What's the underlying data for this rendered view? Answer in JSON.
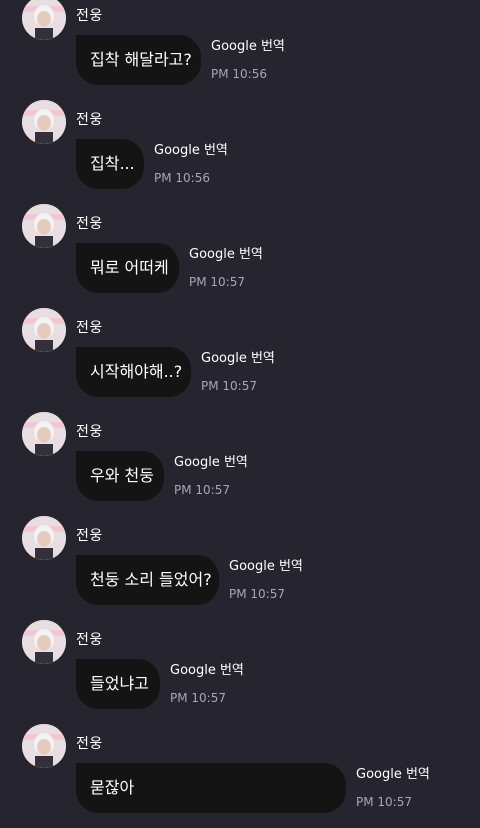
{
  "messages": [
    {
      "sender": "전웅",
      "text": "집착 해달라고?",
      "translate": "Google 번역",
      "time": "PM 10:56"
    },
    {
      "sender": "전웅",
      "text": "집착...",
      "translate": "Google 번역",
      "time": "PM 10:56"
    },
    {
      "sender": "전웅",
      "text": "뭐로 어떠케",
      "translate": "Google 번역",
      "time": "PM 10:57"
    },
    {
      "sender": "전웅",
      "text": "시작해야해..?",
      "translate": "Google 번역",
      "time": "PM 10:57"
    },
    {
      "sender": "전웅",
      "text": "우와 천둥",
      "translate": "Google 번역",
      "time": "PM 10:57"
    },
    {
      "sender": "전웅",
      "text": "천둥 소리 들었어?",
      "translate": "Google 번역",
      "time": "PM 10:57"
    },
    {
      "sender": "전웅",
      "text": "들었냐고",
      "translate": "Google 번역",
      "time": "PM 10:57"
    },
    {
      "sender": "전웅",
      "text": "묻잖아",
      "translate": "Google 번역",
      "time": "PM 10:57"
    }
  ]
}
